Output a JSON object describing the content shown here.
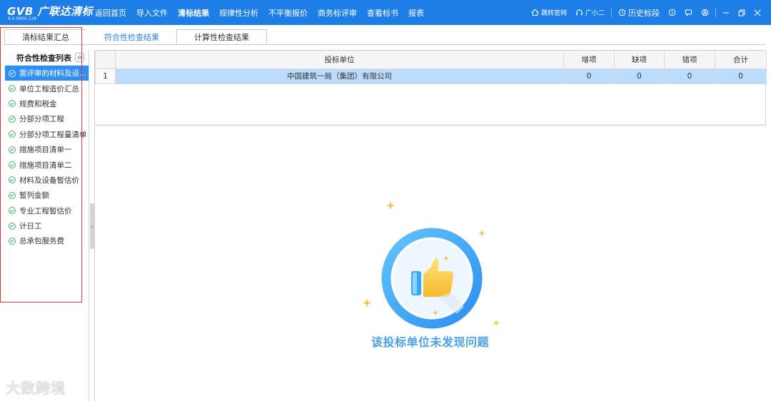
{
  "app": {
    "logo_text": "GVB 广联达清标",
    "version": "6.0.9900.128"
  },
  "menu": {
    "items": [
      {
        "label": "返回首页"
      },
      {
        "label": "导入文件"
      },
      {
        "label": "清标结果"
      },
      {
        "label": "规律性分析"
      },
      {
        "label": "不平衡报价"
      },
      {
        "label": "商务标评审"
      },
      {
        "label": "查看标书"
      },
      {
        "label": "报表"
      }
    ],
    "active_index": 2
  },
  "right_tools": {
    "official_site": "跳转官网",
    "assistant": "广小二",
    "history": "历史标段"
  },
  "tabs": [
    {
      "label": "清标结果汇总"
    },
    {
      "label": "符合性检查结果"
    },
    {
      "label": "计算性检查结果"
    }
  ],
  "left_panel": {
    "title": "符合性检查列表",
    "items": [
      {
        "label": "需评审的材料及设..."
      },
      {
        "label": "单位工程造价汇总"
      },
      {
        "label": "规费和税金"
      },
      {
        "label": "分部分项工程"
      },
      {
        "label": "分部分项工程量清单"
      },
      {
        "label": "措施项目清单一"
      },
      {
        "label": "措施项目清单二"
      },
      {
        "label": "材料及设备暂估价"
      },
      {
        "label": "暂列金额"
      },
      {
        "label": "专业工程暂估价"
      },
      {
        "label": "计日工"
      },
      {
        "label": "总承包服务费"
      }
    ]
  },
  "table": {
    "columns": [
      "",
      "投标单位",
      "增项",
      "缺项",
      "错项",
      "合计"
    ],
    "rows": [
      {
        "num": "1",
        "unit": "中国建筑一局（集团）有限公司",
        "add": "0",
        "missing": "0",
        "wrong": "0",
        "total": "0"
      }
    ]
  },
  "empty_state": {
    "message": "该投标单位未发现问题"
  },
  "watermark": "大数跨境",
  "colors": {
    "topbar": "#1e7ee8",
    "accent": "#2f8ff0",
    "selected_row": "#bcdcff",
    "check_green": "#3cb371",
    "highlight_box": "#e53935"
  }
}
